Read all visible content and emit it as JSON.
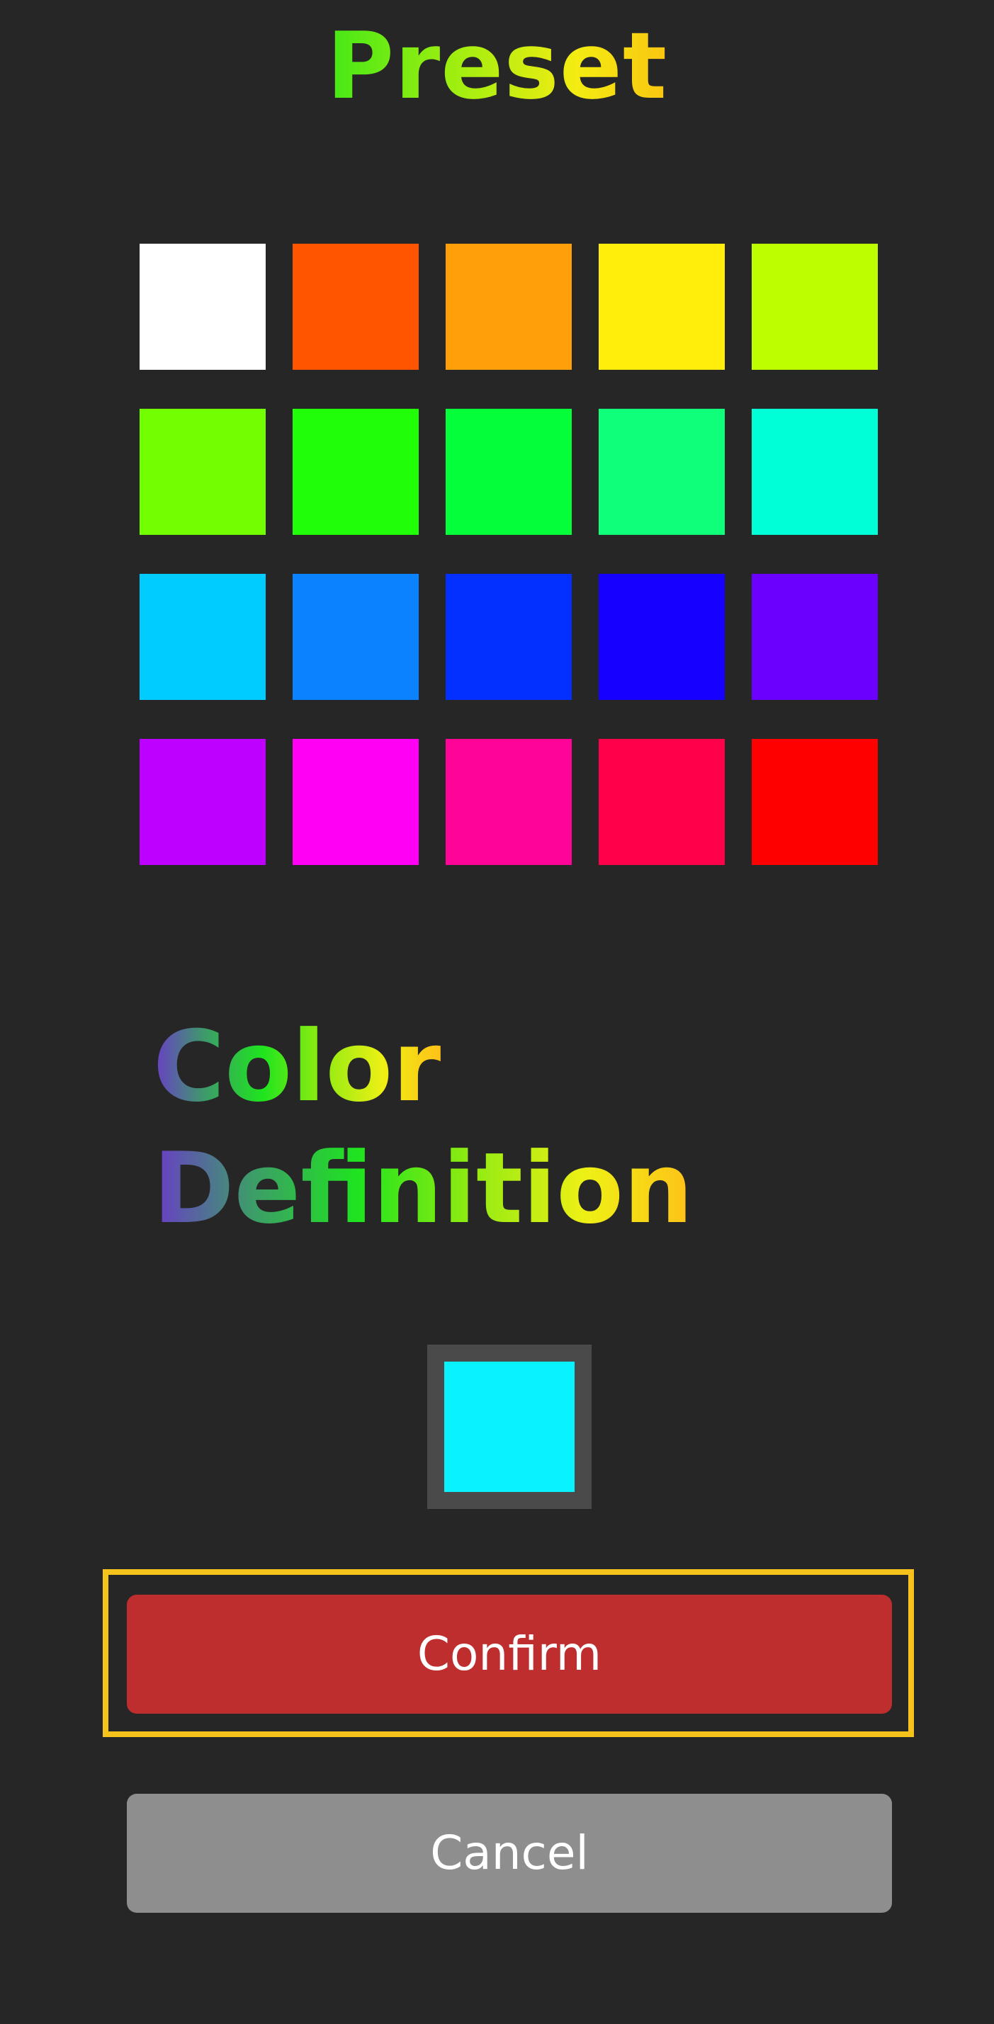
{
  "preset": {
    "title": "Preset",
    "swatches": [
      {
        "name": "swatch-white",
        "color": "#ffffff"
      },
      {
        "name": "swatch-orange-red",
        "color": "#ff5400"
      },
      {
        "name": "swatch-orange",
        "color": "#ffa00a"
      },
      {
        "name": "swatch-yellow",
        "color": "#ffee0c"
      },
      {
        "name": "swatch-lime",
        "color": "#bdff00"
      },
      {
        "name": "swatch-chartreuse",
        "color": "#72ff00"
      },
      {
        "name": "swatch-green",
        "color": "#20ff08"
      },
      {
        "name": "swatch-bright-green",
        "color": "#04ff3a"
      },
      {
        "name": "swatch-spring-green",
        "color": "#10ff7a"
      },
      {
        "name": "swatch-aqua",
        "color": "#00ffd6"
      },
      {
        "name": "swatch-sky-blue",
        "color": "#00ccff"
      },
      {
        "name": "swatch-azure",
        "color": "#0b82ff"
      },
      {
        "name": "swatch-blue",
        "color": "#0330ff"
      },
      {
        "name": "swatch-deep-blue",
        "color": "#1600ff"
      },
      {
        "name": "swatch-violet",
        "color": "#6c00ff"
      },
      {
        "name": "swatch-purple",
        "color": "#bd00ff"
      },
      {
        "name": "swatch-magenta",
        "color": "#ff00f4"
      },
      {
        "name": "swatch-pink",
        "color": "#ff0597"
      },
      {
        "name": "swatch-crimson",
        "color": "#ff004b"
      },
      {
        "name": "swatch-red",
        "color": "#ff0000"
      }
    ]
  },
  "color_definition": {
    "title_line1": "Color",
    "title_line2": "Definition",
    "current_color": "#08f2ff"
  },
  "buttons": {
    "confirm_label": "Confirm",
    "cancel_label": "Cancel"
  },
  "colors": {
    "background": "#272627",
    "confirm": "#bf2e2e",
    "cancel": "#8e8e8e",
    "focus_ring": "#f6c21c",
    "current_color_frame": "#4a4a4a"
  }
}
